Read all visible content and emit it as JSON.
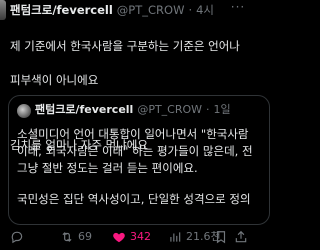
{
  "post": {
    "display_name": "팬텀크로/fevercell",
    "handle": "@PT_CROW",
    "time": "4시",
    "more_label": "···",
    "body_lines": [
      "제 기준에서 한국사람을 구분하는 기준은 언어나",
      "피부색이 아니에요",
      "김치를 얼마나 자주 먹냐에요"
    ]
  },
  "quote": {
    "display_name": "팬텀크로/fevercell",
    "handle": "@PT_CROW",
    "time": "1일",
    "body_lines": [
      "소셜미디어 언어 대통합이 일어나면서 \"한국사람",
      "이래, 외국사람은 이래\" 하는 평가들이 많은데, 전",
      "그냥 절반 정도는 걸러 듣는 편이에요.",
      "국민성은 집단 역사성이고, 단일한 성격으로 정의"
    ]
  },
  "actions": {
    "replies": "",
    "reposts": "69",
    "likes": "342",
    "views": "21.6천",
    "like_color": "#f91880"
  },
  "icons": {
    "reply": "reply-icon",
    "repost": "repost-icon",
    "like": "heart-icon",
    "views": "views-icon",
    "bookmark": "bookmark-icon",
    "share": "share-icon"
  }
}
